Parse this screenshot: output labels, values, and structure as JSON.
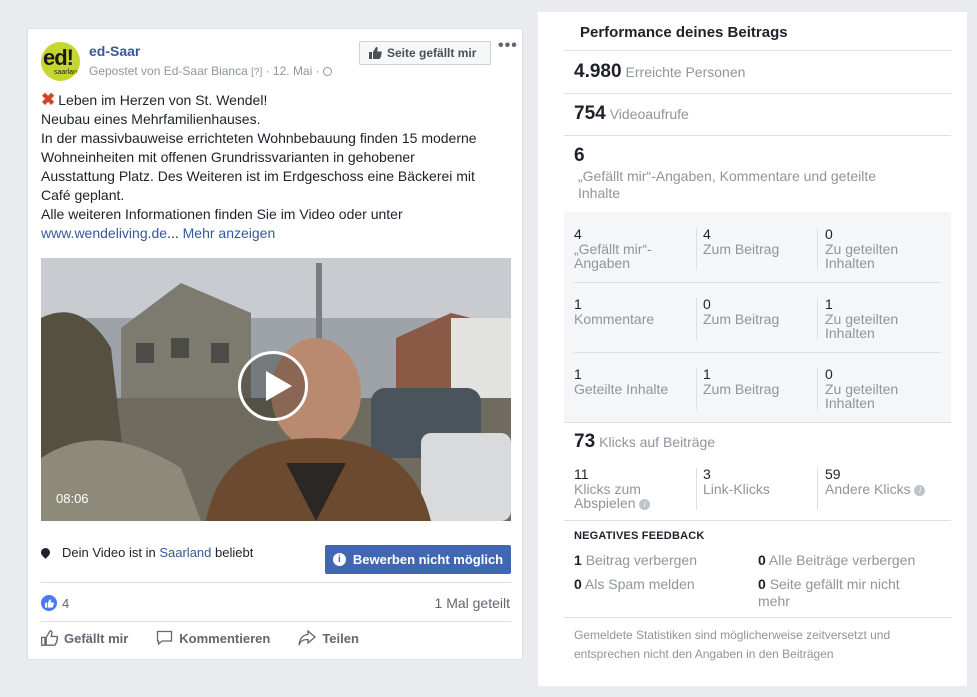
{
  "post": {
    "logo_text": "ed!",
    "logo_subtext": "saarland",
    "page_name": "ed-Saar",
    "posted_by": "Gepostet von Ed-Saar Bianca",
    "help_marker": "[?]",
    "date": "12. Mai",
    "like_page_label": "Seite gefällt mir",
    "more_label": "•••",
    "headline": "Leben im Herzen von St. Wendel!",
    "lines": [
      "Neubau eines Mehrfamilienhauses.",
      "In der massivbauweise errichteten Wohnbebauung finden 15 moderne",
      "Wohneinheiten mit offenen Grundrissvarianten in gehobener",
      "Ausstattung Platz. Des Weiteren ist im Erdgeschoss eine Bäckerei mit",
      "Café geplant.",
      "Alle weiteren Informationen finden Sie im Video oder unter"
    ],
    "link_text": "www.wendeliving.de",
    "ellipsis": "...",
    "more_text": "Mehr anzeigen",
    "video_duration": "08:06",
    "popular_prefix": "Dein Video ist in",
    "popular_region": "Saarland",
    "popular_suffix": "beliebt",
    "boost_label": "Bewerben nicht möglich",
    "reaction_count": "4",
    "shared_label": "1 Mal geteilt",
    "actions": {
      "like": "Gefällt mir",
      "comment": "Kommentieren",
      "share": "Teilen"
    }
  },
  "insights": {
    "title": "Performance deines Beitrags",
    "reach": {
      "value": "4.980",
      "label": "Erreichte Personen"
    },
    "views": {
      "value": "754",
      "label": "Videoaufrufe"
    },
    "engagement": {
      "value": "6",
      "label": "„Gefällt mir“-Angaben, Kommentare und geteilte Inhalte"
    },
    "grid": [
      [
        {
          "value": "4",
          "label": "„Gefällt mir“-Angaben"
        },
        {
          "value": "4",
          "label": "Zum Beitrag"
        },
        {
          "value": "0",
          "label": "Zu geteilten Inhalten"
        }
      ],
      [
        {
          "value": "1",
          "label": "Kommentare"
        },
        {
          "value": "0",
          "label": "Zum Beitrag"
        },
        {
          "value": "1",
          "label": "Zu geteilten Inhalten"
        }
      ],
      [
        {
          "value": "1",
          "label": "Geteilte Inhalte"
        },
        {
          "value": "1",
          "label": "Zum Beitrag"
        },
        {
          "value": "0",
          "label": "Zu geteilten Inhalten"
        }
      ]
    ],
    "clicks": {
      "value": "73",
      "label": "Klicks auf Beiträge"
    },
    "click_breakdown": [
      {
        "value": "11",
        "label": "Klicks zum Abspielen"
      },
      {
        "value": "3",
        "label": "Link-Klicks"
      },
      {
        "value": "59",
        "label": "Andere Klicks"
      }
    ],
    "negative_title": "NEGATIVES FEEDBACK",
    "negative": [
      {
        "value": "1",
        "label": "Beitrag verbergen"
      },
      {
        "value": "0",
        "label": "Alle Beiträge verbergen"
      },
      {
        "value": "0",
        "label": "Als Spam melden"
      },
      {
        "value": "0",
        "label": "Seite gefällt mir nicht mehr"
      }
    ],
    "footnote": "Gemeldete Statistiken sind möglicherweise zeitversetzt und entsprechen nicht den Angaben in den Beiträgen"
  },
  "colors": {
    "link": "#365899",
    "brand": "#4267b2",
    "logo": "#c5d72f",
    "x_mark": "#d2452a"
  }
}
